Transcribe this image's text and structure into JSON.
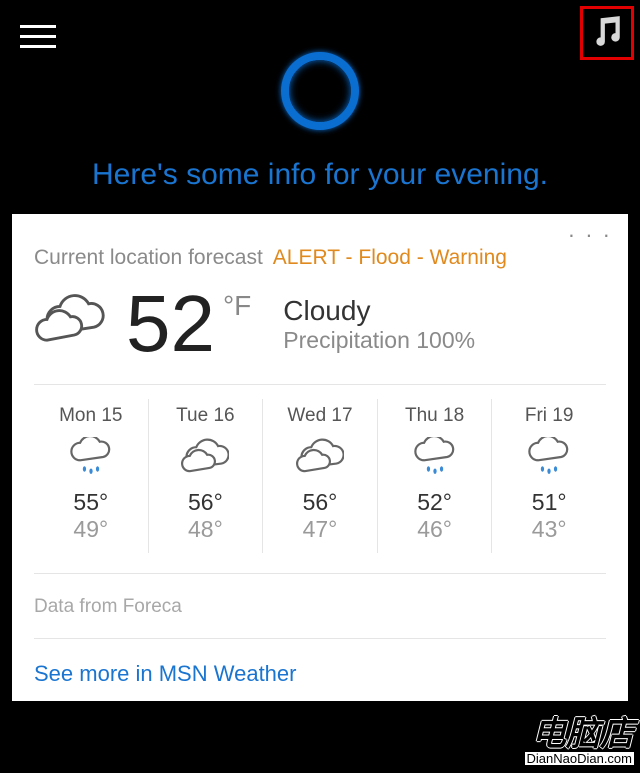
{
  "greeting": "Here's some info for your evening.",
  "card": {
    "forecast_label": "Current location forecast",
    "alert": "ALERT - Flood - Warning",
    "temp": "52",
    "unit": "°F",
    "condition": "Cloudy",
    "precip": "Precipitation 100%",
    "attribution": "Data from Foreca",
    "see_more": "See more in MSN Weather"
  },
  "forecast": [
    {
      "label": "Mon 15",
      "hi": "55°",
      "lo": "49°",
      "icon": "rain"
    },
    {
      "label": "Tue 16",
      "hi": "56°",
      "lo": "48°",
      "icon": "cloud"
    },
    {
      "label": "Wed 17",
      "hi": "56°",
      "lo": "47°",
      "icon": "cloud"
    },
    {
      "label": "Thu 18",
      "hi": "52°",
      "lo": "46°",
      "icon": "rain"
    },
    {
      "label": "Fri 19",
      "hi": "51°",
      "lo": "43°",
      "icon": "rain"
    }
  ],
  "watermark": {
    "cn": "电脑店",
    "en": "DianNaoDian.com"
  },
  "colors": {
    "accent": "#1a75d1",
    "alert": "#e08a1e",
    "highlight_border": "#e20000"
  }
}
